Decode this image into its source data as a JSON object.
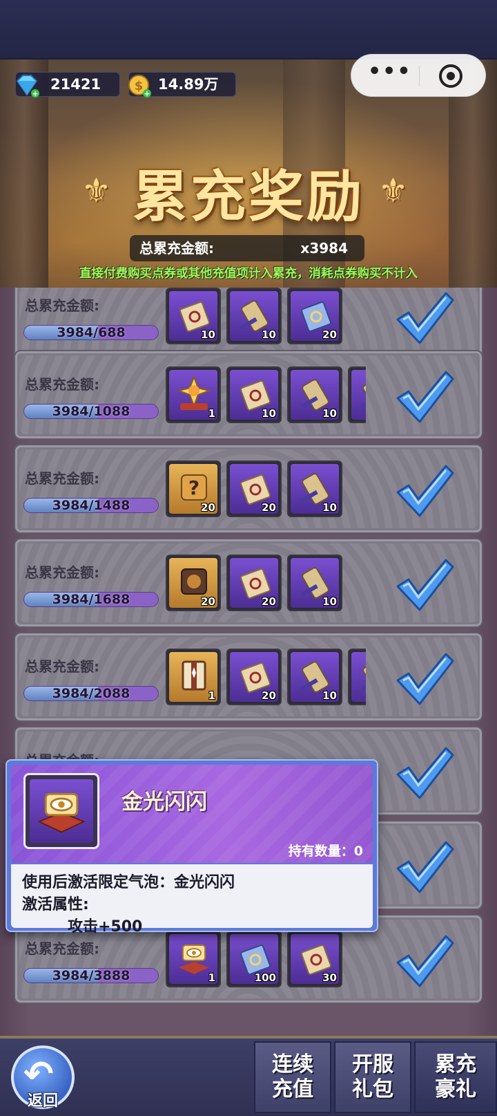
{
  "currency": {
    "diamonds": "21421",
    "coins": "14.89万"
  },
  "banner": {
    "title": "累充奖励",
    "total_label": "总累充金额:",
    "total_value": "x3984",
    "note": "直接付费购买点券或其他充值项计入累充，消耗点券购买不计入"
  },
  "row_label": "总累充金额:",
  "rows": [
    {
      "progress": "3984/688",
      "fraction": 1,
      "items": [
        {
          "icon": "scroll-icon",
          "color": "purple",
          "count": "10"
        },
        {
          "icon": "blade-scroll-icon",
          "color": "purple",
          "count": "10"
        },
        {
          "icon": "blue-scroll-icon",
          "color": "purple",
          "count": "20"
        }
      ]
    },
    {
      "progress": "3984/1088",
      "fraction": 1,
      "items": [
        {
          "icon": "sun-emblem-icon",
          "color": "purple",
          "count": "1"
        },
        {
          "icon": "scroll-icon",
          "color": "purple",
          "count": "10"
        },
        {
          "icon": "blade-scroll-icon",
          "color": "purple",
          "count": "10"
        },
        {
          "icon": "blade-scroll-icon",
          "color": "purple",
          "count": ""
        }
      ]
    },
    {
      "progress": "3984/1488",
      "fraction": 1,
      "items": [
        {
          "icon": "mystery-puzzle-icon",
          "color": "gold",
          "count": "20"
        },
        {
          "icon": "scroll-icon",
          "color": "purple",
          "count": "20"
        },
        {
          "icon": "blade-scroll-icon",
          "color": "purple",
          "count": "10"
        }
      ]
    },
    {
      "progress": "3984/1688",
      "fraction": 1,
      "items": [
        {
          "icon": "puzzle-piece-icon",
          "color": "gold",
          "count": "20"
        },
        {
          "icon": "scroll-icon",
          "color": "purple",
          "count": "20"
        },
        {
          "icon": "blade-scroll-icon",
          "color": "purple",
          "count": "10"
        }
      ]
    },
    {
      "progress": "3984/2088",
      "fraction": 1,
      "items": [
        {
          "icon": "book-icon",
          "color": "gold",
          "count": "1"
        },
        {
          "icon": "scroll-icon",
          "color": "purple",
          "count": "20"
        },
        {
          "icon": "blade-scroll-icon",
          "color": "purple",
          "count": "10"
        },
        {
          "icon": "blade-scroll-icon",
          "color": "purple",
          "count": ""
        }
      ]
    },
    {
      "progress": "",
      "fraction": 1,
      "items": []
    },
    {
      "progress": "",
      "fraction": 1,
      "items": []
    },
    {
      "progress": "3984/3888",
      "fraction": 1,
      "items": [
        {
          "icon": "eye-cushion-icon",
          "color": "purple",
          "count": "1"
        },
        {
          "icon": "blue-scroll-icon",
          "color": "purple",
          "count": "100"
        },
        {
          "icon": "scroll-icon",
          "color": "purple",
          "count": "30"
        }
      ]
    }
  ],
  "tooltip": {
    "name": "金光闪闪",
    "owned_label": "持有数量：0",
    "line1": "使用后激活限定气泡：金光闪闪",
    "line2": "激活属性:",
    "line3": "攻击+500"
  },
  "bottom": {
    "back_label": "返回",
    "tabs": [
      [
        "连续",
        "充值"
      ],
      [
        "开服",
        "礼包"
      ],
      [
        "累充",
        "豪礼"
      ]
    ]
  },
  "colors": {
    "check": "#4d9bf0",
    "progress_fill": "#6b8ed0",
    "progress_track": "#8b62c6"
  }
}
